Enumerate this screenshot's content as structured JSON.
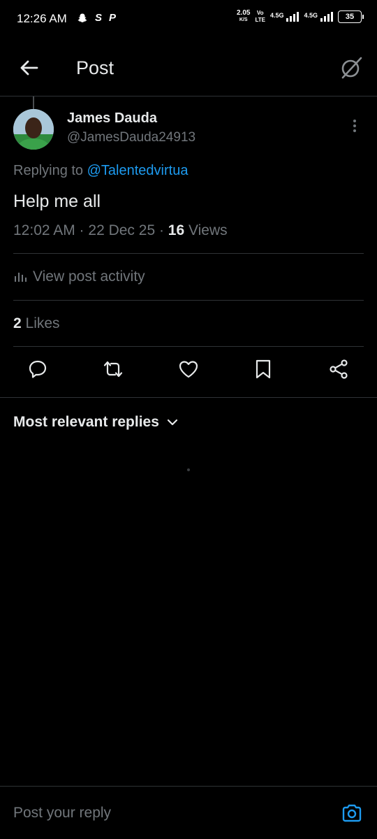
{
  "status_bar": {
    "time": "12:26 AM",
    "app_icons": [
      "snapchat-icon",
      "S",
      "P"
    ],
    "net_speed_value": "2.05",
    "net_speed_unit": "K/S",
    "volte_top": "Vo",
    "volte_bottom": "LTE",
    "signal1_label": "4.5G",
    "signal2_label": "4.5G",
    "battery": "35"
  },
  "header": {
    "title": "Post",
    "back_icon": "arrow-left-icon",
    "grok_icon": "grok-icon"
  },
  "post": {
    "display_name": "James Dauda",
    "handle": "@JamesDauda24913",
    "replying_prefix": "Replying to",
    "replying_to": "@Talentedvirtua",
    "text": "Help me all",
    "timestamp": "12:02 AM · 22 Dec 25 · ",
    "views_count": "16",
    "views_label": " Views",
    "activity_label": "View post activity",
    "likes_count": "2",
    "likes_label": " Likes"
  },
  "actions": [
    "reply-icon",
    "repost-icon",
    "like-icon",
    "bookmark-icon",
    "share-icon"
  ],
  "replies": {
    "sort_label": "Most relevant replies"
  },
  "reply_bar": {
    "placeholder": "Post your reply"
  },
  "colors": {
    "background": "#000000",
    "text_primary": "#e7e9ea",
    "text_secondary": "#71767b",
    "accent": "#1d9bf0",
    "divider": "#2f3336"
  }
}
